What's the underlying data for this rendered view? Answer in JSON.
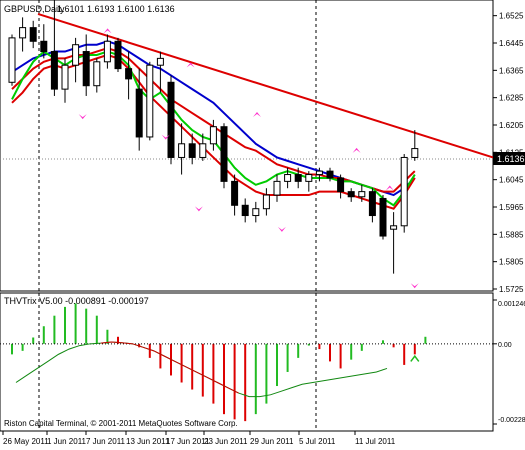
{
  "main_panel": {
    "title": "GBPUSD,Daily",
    "ohlc": "1.6101 1.6193 1.6100 1.6136",
    "price_label": "1.6136",
    "y_ticks": [
      "1.6525",
      "1.6445",
      "1.6365",
      "1.6285",
      "1.6205",
      "1.6125",
      "1.6045",
      "1.5965",
      "1.5885",
      "1.5805",
      "1.5725"
    ]
  },
  "sub_panel": {
    "title": "THVTrix V5.00 -0.000891 -0.000197",
    "y_ticks": [
      "0.001246",
      "0.00",
      "-0.00228"
    ],
    "footer": "Riston Capital Terminal, © 2001-2011 MetaQuotes Software Corp."
  },
  "x_ticks": [
    "26 May 2011",
    "1 Jun 2011",
    "7 Jun 2011",
    "13 Jun 2011",
    "17 Jun 2011",
    "23 Jun 2011",
    "29 Jun 2011",
    "5 Jul 2011",
    "11 Jul 2011"
  ],
  "chart_data": {
    "type": "candlestick",
    "symbol": "GBPUSD",
    "timeframe": "Daily",
    "ylim": [
      1.5725,
      1.6565
    ],
    "candles": [
      {
        "o": 1.633,
        "h": 1.647,
        "l": 1.632,
        "c": 1.646
      },
      {
        "o": 1.646,
        "h": 1.652,
        "l": 1.642,
        "c": 1.649
      },
      {
        "o": 1.649,
        "h": 1.651,
        "l": 1.643,
        "c": 1.645
      },
      {
        "o": 1.645,
        "h": 1.65,
        "l": 1.64,
        "c": 1.642
      },
      {
        "o": 1.642,
        "h": 1.657,
        "l": 1.629,
        "c": 1.631
      },
      {
        "o": 1.631,
        "h": 1.64,
        "l": 1.627,
        "c": 1.638
      },
      {
        "o": 1.638,
        "h": 1.646,
        "l": 1.633,
        "c": 1.644
      },
      {
        "o": 1.642,
        "h": 1.647,
        "l": 1.629,
        "c": 1.632
      },
      {
        "o": 1.632,
        "h": 1.64,
        "l": 1.63,
        "c": 1.639
      },
      {
        "o": 1.639,
        "h": 1.647,
        "l": 1.637,
        "c": 1.645
      },
      {
        "o": 1.645,
        "h": 1.646,
        "l": 1.636,
        "c": 1.637
      },
      {
        "o": 1.637,
        "h": 1.642,
        "l": 1.628,
        "c": 1.634
      },
      {
        "o": 1.631,
        "h": 1.637,
        "l": 1.613,
        "c": 1.617
      },
      {
        "o": 1.617,
        "h": 1.639,
        "l": 1.616,
        "c": 1.638
      },
      {
        "o": 1.638,
        "h": 1.642,
        "l": 1.63,
        "c": 1.64
      },
      {
        "o": 1.633,
        "h": 1.635,
        "l": 1.609,
        "c": 1.611
      },
      {
        "o": 1.611,
        "h": 1.621,
        "l": 1.606,
        "c": 1.615
      },
      {
        "o": 1.615,
        "h": 1.618,
        "l": 1.609,
        "c": 1.611
      },
      {
        "o": 1.611,
        "h": 1.618,
        "l": 1.61,
        "c": 1.615
      },
      {
        "o": 1.615,
        "h": 1.622,
        "l": 1.613,
        "c": 1.62
      },
      {
        "o": 1.62,
        "h": 1.621,
        "l": 1.602,
        "c": 1.604
      },
      {
        "o": 1.604,
        "h": 1.606,
        "l": 1.594,
        "c": 1.597
      },
      {
        "o": 1.597,
        "h": 1.599,
        "l": 1.592,
        "c": 1.594
      },
      {
        "o": 1.594,
        "h": 1.598,
        "l": 1.592,
        "c": 1.596
      },
      {
        "o": 1.596,
        "h": 1.602,
        "l": 1.594,
        "c": 1.6
      },
      {
        "o": 1.6,
        "h": 1.606,
        "l": 1.598,
        "c": 1.604
      },
      {
        "o": 1.604,
        "h": 1.608,
        "l": 1.602,
        "c": 1.606
      },
      {
        "o": 1.606,
        "h": 1.608,
        "l": 1.602,
        "c": 1.604
      },
      {
        "o": 1.604,
        "h": 1.607,
        "l": 1.601,
        "c": 1.606
      },
      {
        "o": 1.606,
        "h": 1.608,
        "l": 1.604,
        "c": 1.607
      },
      {
        "o": 1.607,
        "h": 1.608,
        "l": 1.604,
        "c": 1.605
      },
      {
        "o": 1.605,
        "h": 1.606,
        "l": 1.599,
        "c": 1.601
      },
      {
        "o": 1.601,
        "h": 1.602,
        "l": 1.598,
        "c": 1.5995
      },
      {
        "o": 1.5995,
        "h": 1.603,
        "l": 1.598,
        "c": 1.601
      },
      {
        "o": 1.601,
        "h": 1.602,
        "l": 1.592,
        "c": 1.594
      },
      {
        "o": 1.599,
        "h": 1.6,
        "l": 1.587,
        "c": 1.588
      },
      {
        "o": 1.59,
        "h": 1.595,
        "l": 1.577,
        "c": 1.591
      },
      {
        "o": 1.591,
        "h": 1.612,
        "l": 1.589,
        "c": 1.611
      },
      {
        "o": 1.611,
        "h": 1.619,
        "l": 1.61,
        "c": 1.6136
      }
    ],
    "trendline": [
      [
        0,
        1.653
      ],
      [
        42,
        1.611
      ]
    ],
    "moving_averages": [
      {
        "color": "#0000cc",
        "values": [
          1.636,
          1.638,
          1.64,
          1.641,
          1.642,
          1.642,
          1.643,
          1.644,
          1.644,
          1.645,
          1.644,
          1.642,
          1.64,
          1.638,
          1.637,
          1.635,
          1.633,
          1.631,
          1.629,
          1.627,
          1.624,
          1.621,
          1.618,
          1.615,
          1.613,
          1.611,
          1.61,
          1.609,
          1.608,
          1.607,
          1.606,
          1.605,
          1.604,
          1.603,
          1.602,
          1.601,
          1.6,
          1.602,
          1.605
        ]
      },
      {
        "color": "#dd0000",
        "values": [
          1.631,
          1.634,
          1.637,
          1.639,
          1.64,
          1.64,
          1.641,
          1.641,
          1.642,
          1.643,
          1.642,
          1.64,
          1.637,
          1.634,
          1.631,
          1.628,
          1.626,
          1.624,
          1.622,
          1.62,
          1.618,
          1.616,
          1.614,
          1.613,
          1.611,
          1.609,
          1.608,
          1.607,
          1.606,
          1.606,
          1.605,
          1.605,
          1.604,
          1.603,
          1.602,
          1.601,
          1.601,
          1.604,
          1.607
        ]
      },
      {
        "color": "#dd0000",
        "values": [
          1.627,
          1.63,
          1.634,
          1.637,
          1.638,
          1.637,
          1.638,
          1.639,
          1.64,
          1.641,
          1.64,
          1.637,
          1.633,
          1.629,
          1.626,
          1.623,
          1.62,
          1.617,
          1.614,
          1.611,
          1.608,
          1.605,
          1.603,
          1.601,
          1.6,
          1.6,
          1.6,
          1.6,
          1.6,
          1.601,
          1.601,
          1.601,
          1.6,
          1.599,
          1.598,
          1.597,
          1.596,
          1.6,
          1.605
        ]
      },
      {
        "color": "#00cc00",
        "values": [
          1.628,
          1.634,
          1.639,
          1.642,
          1.64,
          1.638,
          1.64,
          1.641,
          1.641,
          1.642,
          1.641,
          1.638,
          1.631,
          1.628,
          1.63,
          1.626,
          1.622,
          1.619,
          1.617,
          1.616,
          1.612,
          1.608,
          1.605,
          1.603,
          1.604,
          1.606,
          1.607,
          1.606,
          1.605,
          1.605,
          1.605,
          1.604,
          1.604,
          1.603,
          1.602,
          1.599,
          1.597,
          1.601,
          1.606
        ]
      }
    ],
    "arrows_up": [
      {
        "i": 12,
        "v": 1.6485
      },
      {
        "i": 22,
        "v": 1.6385
      },
      {
        "i": 30,
        "v": 1.624
      },
      {
        "i": 42,
        "v": 1.6135
      },
      {
        "i": 46,
        "v": 1.6025
      }
    ],
    "arrows_down": [
      {
        "i": 9,
        "v": 1.6225
      },
      {
        "i": 19,
        "v": 1.6165
      },
      {
        "i": 23,
        "v": 1.5955
      },
      {
        "i": 33,
        "v": 1.5895
      },
      {
        "i": 49,
        "v": 1.573
      }
    ],
    "indicator": {
      "name": "THVTrix V5.00",
      "ylim": [
        -0.00228,
        0.001246
      ],
      "histogram": [
        -0.0003,
        -0.0002,
        0.00018,
        0.0005,
        0.0008,
        0.00105,
        0.00115,
        0.001,
        0.0008,
        0.0004,
        0.0002,
        0.0,
        -0.0001,
        -0.0004,
        -0.0007,
        -0.0009,
        -0.0011,
        -0.0013,
        -0.0015,
        -0.0017,
        -0.002,
        -0.00215,
        -0.0022,
        -0.002,
        -0.0017,
        -0.0012,
        -0.0008,
        -0.0004,
        -5e-05,
        -0.00015,
        -0.0005,
        -0.0007,
        -0.00045,
        -0.0002,
        0.0,
        0.0001,
        -0.0001,
        -0.0006,
        -0.0003,
        0.0002
      ],
      "signal": [
        -0.0011,
        -0.0009,
        -0.0007,
        -0.0005,
        -0.0003,
        -0.00015,
        -5e-05,
        0.0,
        2e-05,
        5e-05,
        3e-05,
        0.0,
        -0.0001,
        -0.0002,
        -0.00035,
        -0.0005,
        -0.00065,
        -0.0008,
        -0.00095,
        -0.0011,
        -0.00125,
        -0.0014,
        -0.0015,
        -0.0015,
        -0.00145,
        -0.00135,
        -0.00125,
        -0.00115,
        -0.0011,
        -0.00105,
        -0.001,
        -0.00095,
        -0.0009,
        -0.00085,
        -0.0008,
        -0.0007
      ]
    }
  }
}
